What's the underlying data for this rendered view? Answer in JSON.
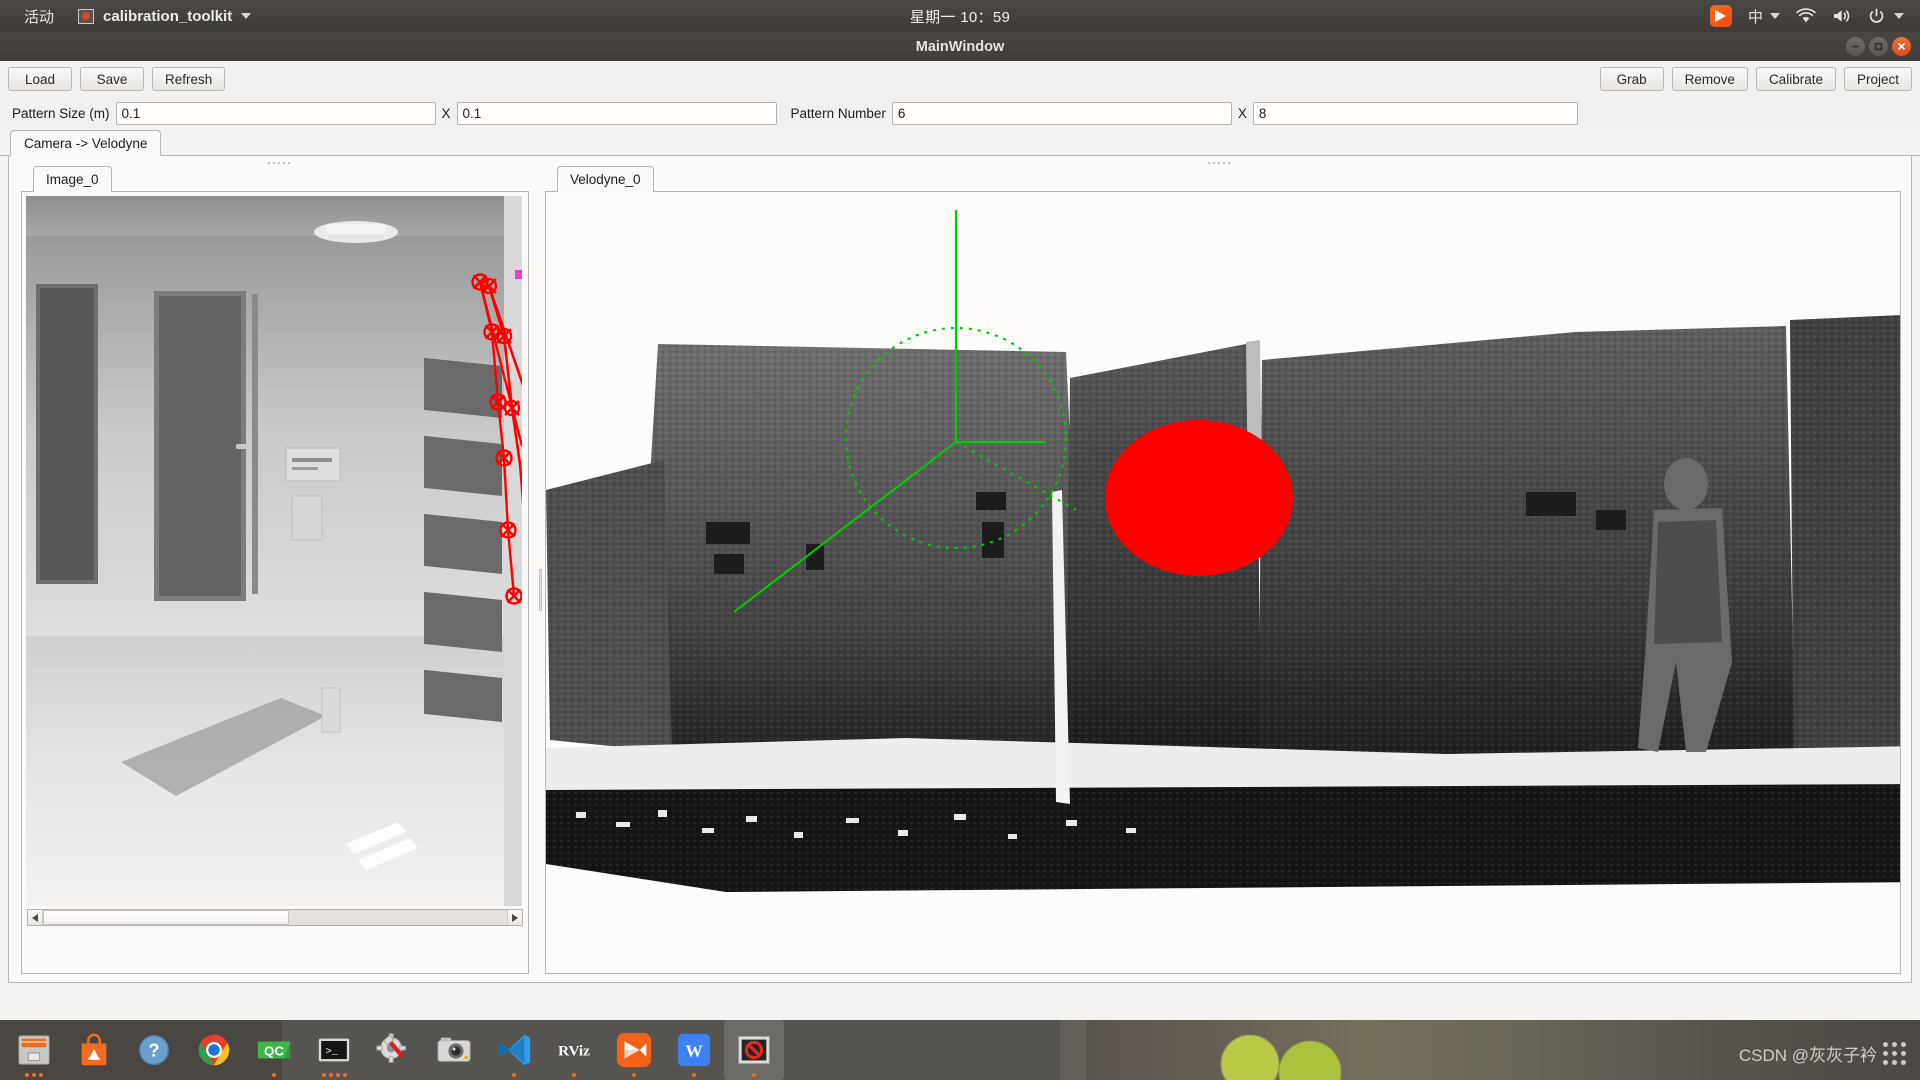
{
  "topbar": {
    "activities": "活动",
    "app_name": "calibration_toolkit",
    "app_icon": "app-square-icon",
    "clock": "星期一 10：59",
    "indicators": [
      {
        "name": "foxmail-tray-icon",
        "label": ""
      },
      {
        "name": "input-method-indicator",
        "label": "中"
      },
      {
        "name": "wifi-icon",
        "label": ""
      },
      {
        "name": "volume-icon",
        "label": ""
      },
      {
        "name": "power-icon",
        "label": ""
      }
    ]
  },
  "window": {
    "title": "MainWindow",
    "controls": {
      "minimize": "–",
      "maximize": "□",
      "close": "×"
    }
  },
  "toolbar": {
    "left_buttons": [
      {
        "label": "Load",
        "name": "load-button"
      },
      {
        "label": "Save",
        "name": "save-button"
      },
      {
        "label": "Refresh",
        "name": "refresh-button"
      }
    ],
    "right_buttons": [
      {
        "label": "Grab",
        "name": "grab-button"
      },
      {
        "label": "Remove",
        "name": "remove-button"
      },
      {
        "label": "Calibrate",
        "name": "calibrate-button"
      },
      {
        "label": "Project",
        "name": "project-button"
      }
    ]
  },
  "params": {
    "pattern_size_label": "Pattern Size (m)",
    "pattern_size_x": "0.1",
    "pattern_size_sep": "X",
    "pattern_size_y": "0.1",
    "pattern_number_label": "Pattern Number",
    "pattern_number_x": "6",
    "pattern_number_sep": "X",
    "pattern_number_y": "8"
  },
  "tabs": {
    "main_tab": "Camera -> Velodyne",
    "image_tab": "Image_0",
    "velodyne_tab": "Velodyne_0"
  },
  "viewers": {
    "image_view_name": "camera-image-view",
    "pointcloud_view_name": "velodyne-pointcloud-view",
    "marker_color": "#ff0000",
    "axis_color": "#00dd00"
  },
  "dock": {
    "items": [
      {
        "name": "files-icon",
        "label": "Files",
        "running": true
      },
      {
        "name": "ubuntu-software-icon",
        "label": "Ubuntu Software",
        "running": false
      },
      {
        "name": "help-icon",
        "label": "Help",
        "running": false
      },
      {
        "name": "chrome-icon",
        "label": "Google Chrome",
        "running": true
      },
      {
        "name": "qtcreator-icon",
        "label": "QC",
        "running": true
      },
      {
        "name": "terminal-icon",
        "label": "Terminal",
        "running": true
      },
      {
        "name": "settings-icon",
        "label": "Settings",
        "running": false
      },
      {
        "name": "camera-icon",
        "label": "Camera",
        "running": false
      },
      {
        "name": "vscode-icon",
        "label": "Visual Studio Code",
        "running": true
      },
      {
        "name": "rviz-icon",
        "label": "RViz",
        "running": true
      },
      {
        "name": "foxmail-icon",
        "label": "Foxmail",
        "running": true
      },
      {
        "name": "wps-icon",
        "label": "WPS",
        "running": true
      },
      {
        "name": "calibration-toolkit-icon",
        "label": "calibration_toolkit",
        "running": true
      }
    ]
  },
  "watermark": {
    "text": "CSDN @灰灰子衿"
  }
}
